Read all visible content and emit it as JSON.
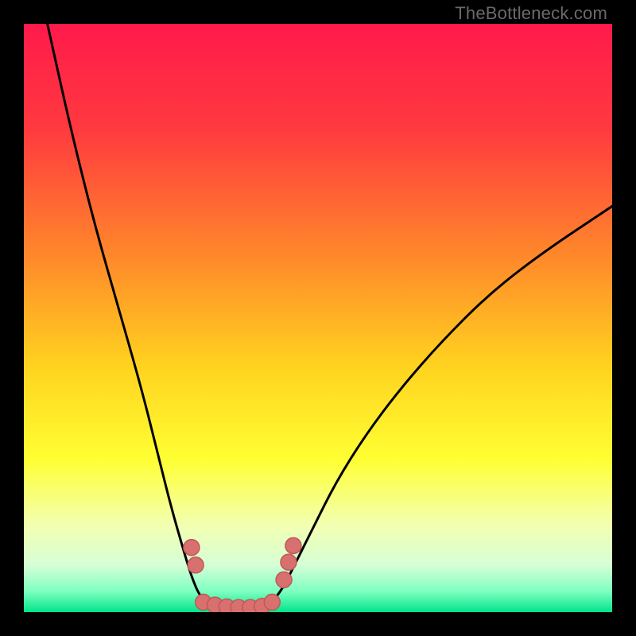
{
  "watermark": "TheBottleneck.com",
  "chart_data": {
    "type": "line",
    "title": "",
    "xlabel": "",
    "ylabel": "",
    "xlim": [
      0,
      100
    ],
    "ylim": [
      0,
      100
    ],
    "background_gradient": [
      {
        "pos": 0.0,
        "color": "#ff1a4b"
      },
      {
        "pos": 0.18,
        "color": "#ff3a3f"
      },
      {
        "pos": 0.4,
        "color": "#ff8a2a"
      },
      {
        "pos": 0.58,
        "color": "#ffd21f"
      },
      {
        "pos": 0.74,
        "color": "#ffff33"
      },
      {
        "pos": 0.85,
        "color": "#f3ffb0"
      },
      {
        "pos": 0.92,
        "color": "#d6ffd6"
      },
      {
        "pos": 0.965,
        "color": "#7dffc0"
      },
      {
        "pos": 1.0,
        "color": "#00e58a"
      }
    ],
    "series": [
      {
        "name": "left-curve",
        "stroke": "#000000",
        "points": [
          {
            "x": 4,
            "y": 100
          },
          {
            "x": 8,
            "y": 82
          },
          {
            "x": 12,
            "y": 66
          },
          {
            "x": 16,
            "y": 52
          },
          {
            "x": 20,
            "y": 38
          },
          {
            "x": 23,
            "y": 26
          },
          {
            "x": 25,
            "y": 18
          },
          {
            "x": 27,
            "y": 11
          },
          {
            "x": 28.5,
            "y": 6
          },
          {
            "x": 30,
            "y": 2.5
          },
          {
            "x": 32,
            "y": 1
          },
          {
            "x": 34,
            "y": 0.5
          }
        ]
      },
      {
        "name": "trough",
        "stroke": "#000000",
        "points": [
          {
            "x": 34,
            "y": 0.5
          },
          {
            "x": 37,
            "y": 0.3
          },
          {
            "x": 40,
            "y": 0.5
          }
        ]
      },
      {
        "name": "right-curve",
        "stroke": "#000000",
        "points": [
          {
            "x": 40,
            "y": 0.5
          },
          {
            "x": 42,
            "y": 1.5
          },
          {
            "x": 44,
            "y": 4
          },
          {
            "x": 46,
            "y": 8
          },
          {
            "x": 49,
            "y": 14
          },
          {
            "x": 53,
            "y": 22
          },
          {
            "x": 58,
            "y": 30
          },
          {
            "x": 64,
            "y": 38
          },
          {
            "x": 71,
            "y": 46
          },
          {
            "x": 79,
            "y": 54
          },
          {
            "x": 88,
            "y": 61
          },
          {
            "x": 100,
            "y": 69
          }
        ]
      }
    ],
    "markers": {
      "name": "highlighted-dots",
      "fill": "#d97070",
      "stroke": "#c05858",
      "radius_px": 10,
      "points": [
        {
          "x": 28.5,
          "y": 11
        },
        {
          "x": 29.2,
          "y": 8
        },
        {
          "x": 30.5,
          "y": 1.7
        },
        {
          "x": 32.5,
          "y": 1.2
        },
        {
          "x": 34.5,
          "y": 0.9
        },
        {
          "x": 36.5,
          "y": 0.8
        },
        {
          "x": 38.5,
          "y": 0.8
        },
        {
          "x": 40.5,
          "y": 1.0
        },
        {
          "x": 42.2,
          "y": 1.7
        },
        {
          "x": 44.2,
          "y": 5.5
        },
        {
          "x": 45.0,
          "y": 8.5
        },
        {
          "x": 45.8,
          "y": 11.3
        }
      ]
    }
  }
}
